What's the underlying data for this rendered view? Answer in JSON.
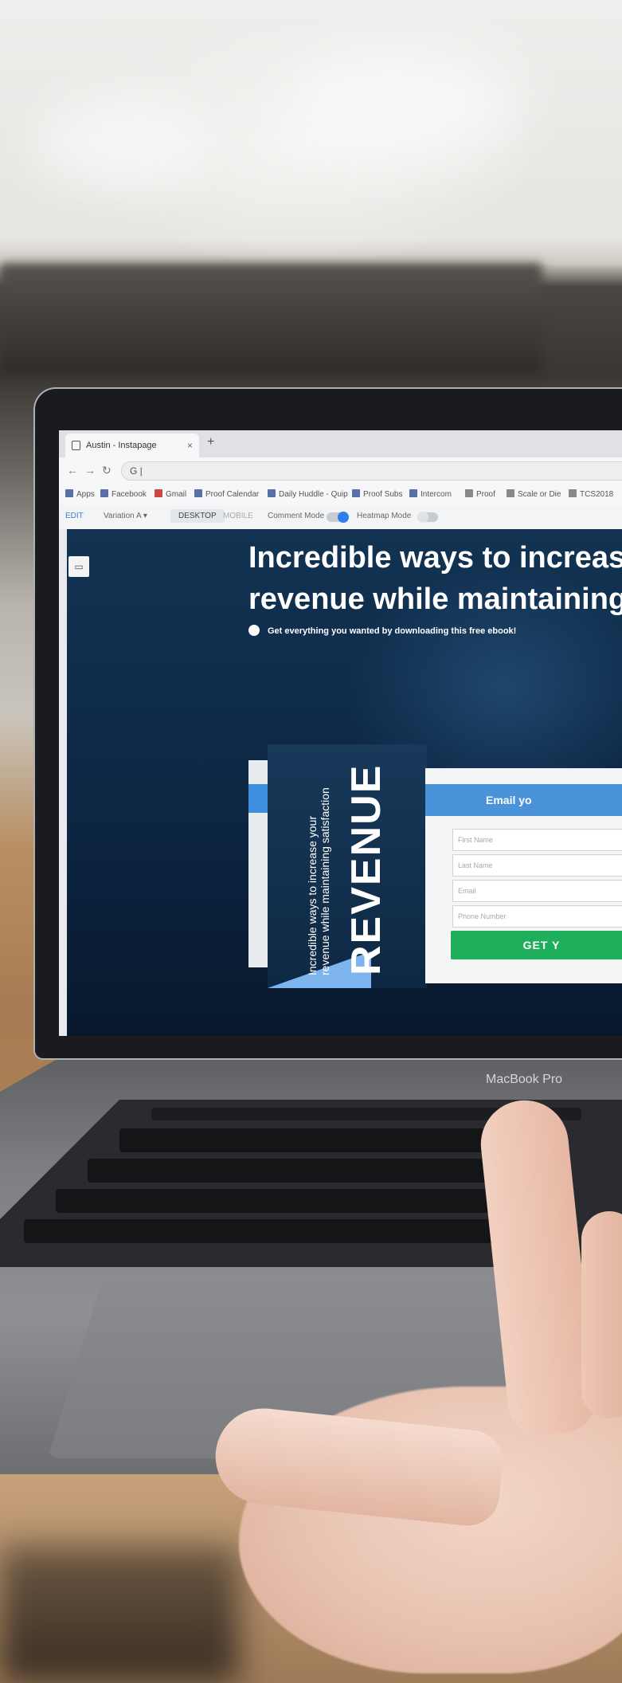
{
  "browser": {
    "tab_title": "Austin - Instapage",
    "tab_close": "×",
    "new_tab": "+",
    "url_text": "G |",
    "bookmarks": [
      "Apps",
      "Facebook",
      "Gmail",
      "Proof Calendar",
      "Daily Huddle - Quip",
      "Proof Subs",
      "Intercom",
      "Proof",
      "Scale or Die",
      "TCS2018"
    ]
  },
  "editor": {
    "edit": "EDIT",
    "variation": "Variation A ▾",
    "desktop": "DESKTOP",
    "mobile": "MOBILE",
    "comment_mode": "Comment Mode",
    "heatmap_mode": "Heatmap Mode"
  },
  "page": {
    "headline_line1": "Incredible ways to increase y",
    "headline_line2": "revenue while maintaining sa",
    "subheadline": "Get everything you wanted by downloading this free ebook!",
    "book": {
      "title": "REVENUE",
      "tagline_line1": "Incredible ways to increase your",
      "tagline_line2": "revenue while maintaining satisfaction"
    },
    "form": {
      "heading": "Email yo",
      "first_name": "First Name",
      "last_name": "Last Name",
      "email": "Email",
      "phone": "Phone Number",
      "submit": "GET Y"
    }
  },
  "device": {
    "model_label": "MacBook Pro"
  },
  "colors": {
    "page_bg": "#0d2740",
    "accent_blue": "#4a93d8",
    "submit_green": "#1fae5b"
  }
}
